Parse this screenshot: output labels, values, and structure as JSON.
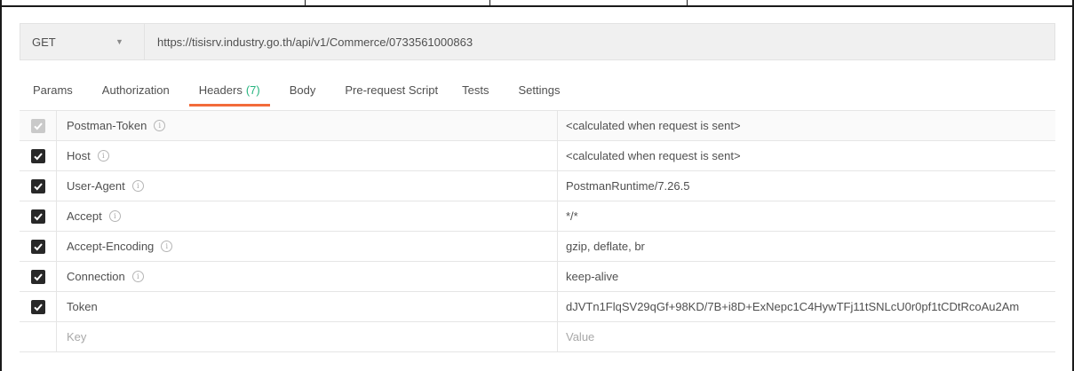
{
  "request": {
    "method": "GET",
    "url": "https://tisisrv.industry.go.th/api/v1/Commerce/0733561000863"
  },
  "tabs": [
    {
      "label": "Params"
    },
    {
      "label": "Authorization"
    },
    {
      "label": "Headers",
      "count": "(7)",
      "active": true
    },
    {
      "label": "Body"
    },
    {
      "label": "Pre-request Script"
    },
    {
      "label": "Tests"
    },
    {
      "label": "Settings"
    }
  ],
  "headers": [
    {
      "key": "Postman-Token",
      "value": "<calculated when request is sent>",
      "checked": true,
      "disabled": true,
      "info": true
    },
    {
      "key": "Host",
      "value": "<calculated when request is sent>",
      "checked": true,
      "info": true
    },
    {
      "key": "User-Agent",
      "value": "PostmanRuntime/7.26.5",
      "checked": true,
      "info": true
    },
    {
      "key": "Accept",
      "value": "*/*",
      "checked": true,
      "info": true
    },
    {
      "key": "Accept-Encoding",
      "value": "gzip, deflate, br",
      "checked": true,
      "info": true
    },
    {
      "key": "Connection",
      "value": "keep-alive",
      "checked": true,
      "info": true
    },
    {
      "key": "Token",
      "value": "dJVTn1FlqSV29qGf+98KD/7B+i8D+ExNepc1C4HywTFj11tSNLcU0r0pf1tCDtRcoAu2Am",
      "checked": true,
      "info": false
    }
  ],
  "new_row": {
    "key_placeholder": "Key",
    "value_placeholder": "Value"
  },
  "colors": {
    "accent_tab": "#f26b3a",
    "count_green": "#26b47f",
    "checkbox": "#282828"
  }
}
